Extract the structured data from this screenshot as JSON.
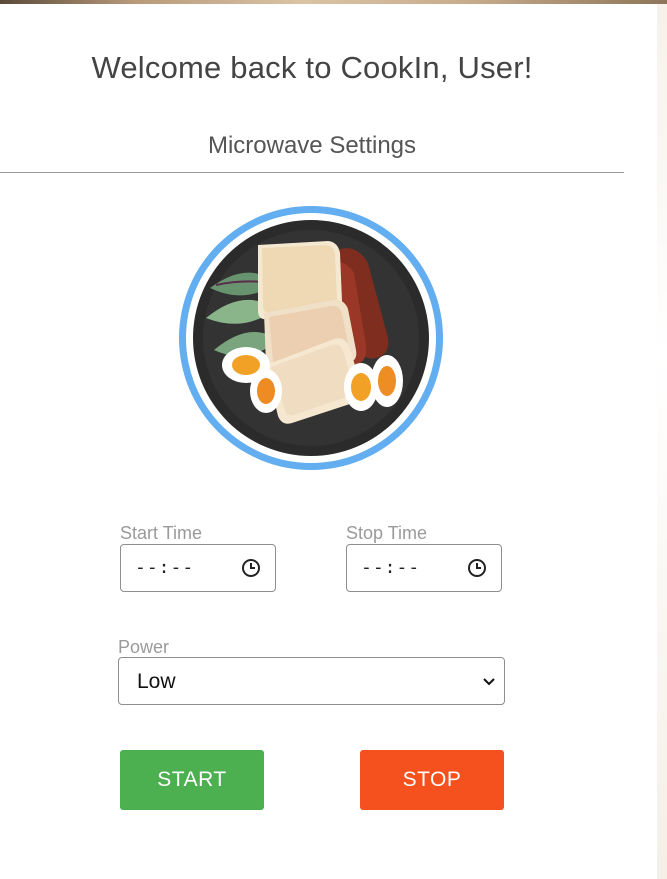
{
  "header": {
    "welcome_text": "Welcome back to CookIn, User!",
    "section_title": "Microwave Settings"
  },
  "form": {
    "start_time": {
      "label": "Start Time",
      "value": "--:--"
    },
    "stop_time": {
      "label": "Stop Time",
      "value": "--:--"
    },
    "power": {
      "label": "Power",
      "selected": "Low"
    }
  },
  "buttons": {
    "start_label": "START",
    "stop_label": "STOP"
  },
  "colors": {
    "start": "#4caf50",
    "stop": "#f4511e",
    "plate_rim": "#62aef0"
  },
  "icons": {
    "time_picker": "clock-icon",
    "dropdown": "chevron-down-icon"
  }
}
